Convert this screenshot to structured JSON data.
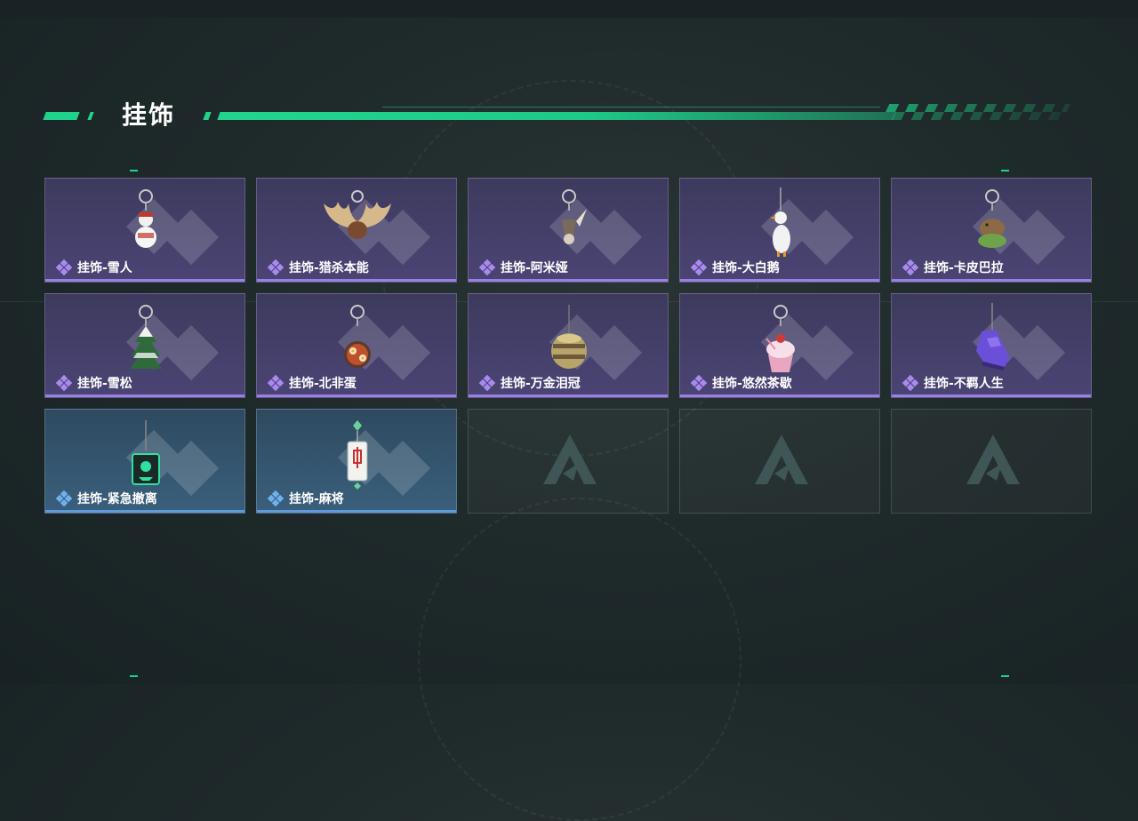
{
  "section": {
    "title": "挂饰"
  },
  "colors": {
    "accent": "#1fd38a",
    "purple_rarity": "#9a7fe6",
    "blue_rarity": "#5e9bd9"
  },
  "items": [
    {
      "label": "挂饰-雪人",
      "rarity": "purple",
      "icon": "snowman-charm-icon"
    },
    {
      "label": "挂饰-猎杀本能",
      "rarity": "purple",
      "icon": "moose-antlers-charm-icon"
    },
    {
      "label": "挂饰-阿米娅",
      "rarity": "purple",
      "icon": "amiya-charm-icon"
    },
    {
      "label": "挂饰-大白鹅",
      "rarity": "purple",
      "icon": "white-goose-charm-icon"
    },
    {
      "label": "挂饰-卡皮巴拉",
      "rarity": "purple",
      "icon": "capybara-charm-icon"
    },
    {
      "label": "挂饰-雪松",
      "rarity": "purple",
      "icon": "snowy-pine-charm-icon"
    },
    {
      "label": "挂饰-北非蛋",
      "rarity": "purple",
      "icon": "shakshuka-charm-icon"
    },
    {
      "label": "挂饰-万金泪冠",
      "rarity": "purple",
      "icon": "golden-crown-charm-icon"
    },
    {
      "label": "挂饰-悠然茶歇",
      "rarity": "purple",
      "icon": "cupcake-charm-icon"
    },
    {
      "label": "挂饰-不羁人生",
      "rarity": "purple",
      "icon": "sneaker-charm-icon"
    },
    {
      "label": "挂饰-紧急撤离",
      "rarity": "blue",
      "icon": "emergency-exit-charm-icon"
    },
    {
      "label": "挂饰-麻将",
      "rarity": "blue",
      "icon": "mahjong-tile-charm-icon"
    }
  ],
  "empty_slots": 3
}
